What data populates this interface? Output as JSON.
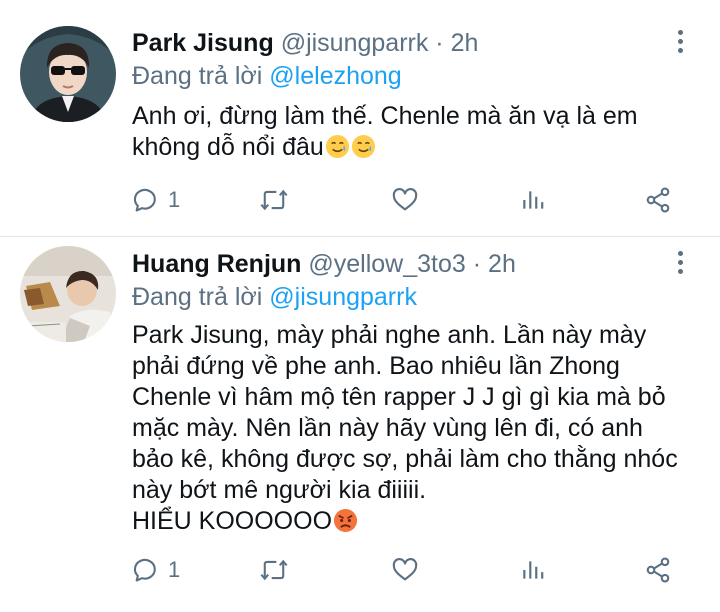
{
  "tweets": [
    {
      "author_name": "Park Jisung",
      "handle": "@jisungparrk",
      "separator": "·",
      "time": "2h",
      "reply_prefix": "Đang trả lời",
      "reply_to": "@lelezhong",
      "body_lines": [
        "Anh ơi, đừng làm thế. Chenle mà ăn vạ là em",
        "không dỗ nổi đâu"
      ],
      "emojis": [
        "smiling-face-with-tear",
        "smiling-face-with-tear"
      ],
      "reply_count": "1",
      "retweet_count": "",
      "like_count": ""
    },
    {
      "author_name": "Huang Renjun",
      "handle": "@yellow_3to3",
      "separator": "·",
      "time": "2h",
      "reply_prefix": "Đang trả lời",
      "reply_to": "@jisungparrk",
      "body_lines": [
        "Park Jisung, mày phải nghe anh. Lần này mày",
        "phải đứng về phe anh. Bao nhiêu lần Zhong",
        "Chenle vì hâm mộ tên rapper J J gì gì kia mà bỏ",
        "mặc mày. Nên lần này hãy vùng lên đi, có anh",
        "bảo kê, không được sợ, phải làm cho thằng nhóc",
        "này bớt mê người kia điiiii.",
        "HIỂU KOOOOOO"
      ],
      "emojis": [
        "angry-face"
      ],
      "reply_count": "1",
      "retweet_count": "",
      "like_count": ""
    }
  ],
  "colors": {
    "secondary_text": "#5b7083",
    "mention": "#1da1f2",
    "divider": "#e1e8ed"
  }
}
